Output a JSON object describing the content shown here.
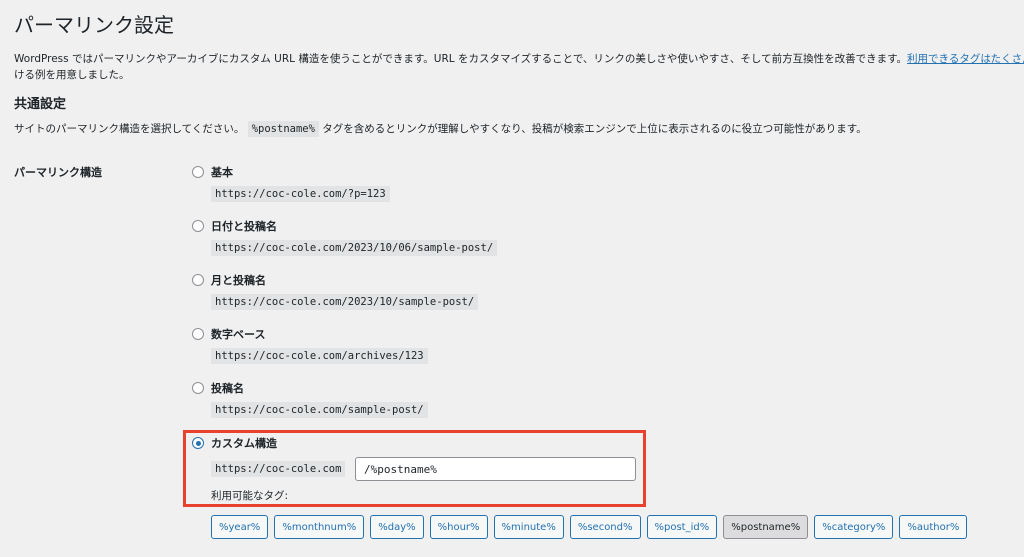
{
  "page": {
    "title": "パーマリンク設定",
    "description_line1": "WordPress ではパーマリンクやアーカイブにカスタム URL 構造を使うことができます。URL をカスタマイズすることで、リンクの美しさや使いやすさ、そして前方互換性を改善できます。",
    "description_link": "利用できるタグはたくさんあ",
    "description_line2": "ける例を用意しました。"
  },
  "common": {
    "title": "共通設定",
    "desc_before": "サイトのパーマリンク構造を選択してください。",
    "desc_code": "%postname%",
    "desc_after": "タグを含めるとリンクが理解しやすくなり、投稿が検索エンジンで上位に表示されるのに役立つ可能性があります。"
  },
  "permalink": {
    "label": "パーマリンク構造",
    "options": [
      {
        "label": "基本",
        "example": "https://coc-cole.com/?p=123",
        "checked": false
      },
      {
        "label": "日付と投稿名",
        "example": "https://coc-cole.com/2023/10/06/sample-post/",
        "checked": false
      },
      {
        "label": "月と投稿名",
        "example": "https://coc-cole.com/2023/10/sample-post/",
        "checked": false
      },
      {
        "label": "数字ベース",
        "example": "https://coc-cole.com/archives/123",
        "checked": false
      },
      {
        "label": "投稿名",
        "example": "https://coc-cole.com/sample-post/",
        "checked": false
      }
    ],
    "custom": {
      "label": "カスタム構造",
      "checked": true,
      "base": "https://coc-cole.com",
      "value": "/%postname%",
      "tags_label": "利用可能なタグ:",
      "tags": [
        "%year%",
        "%monthnum%",
        "%day%",
        "%hour%",
        "%minute%",
        "%second%",
        "%post_id%",
        "%postname%",
        "%category%",
        "%author%"
      ],
      "active_tag": "%postname%"
    }
  },
  "colors": {
    "link": "#2271b1",
    "highlight_border": "#e8412f",
    "background": "#f0f0f1"
  }
}
